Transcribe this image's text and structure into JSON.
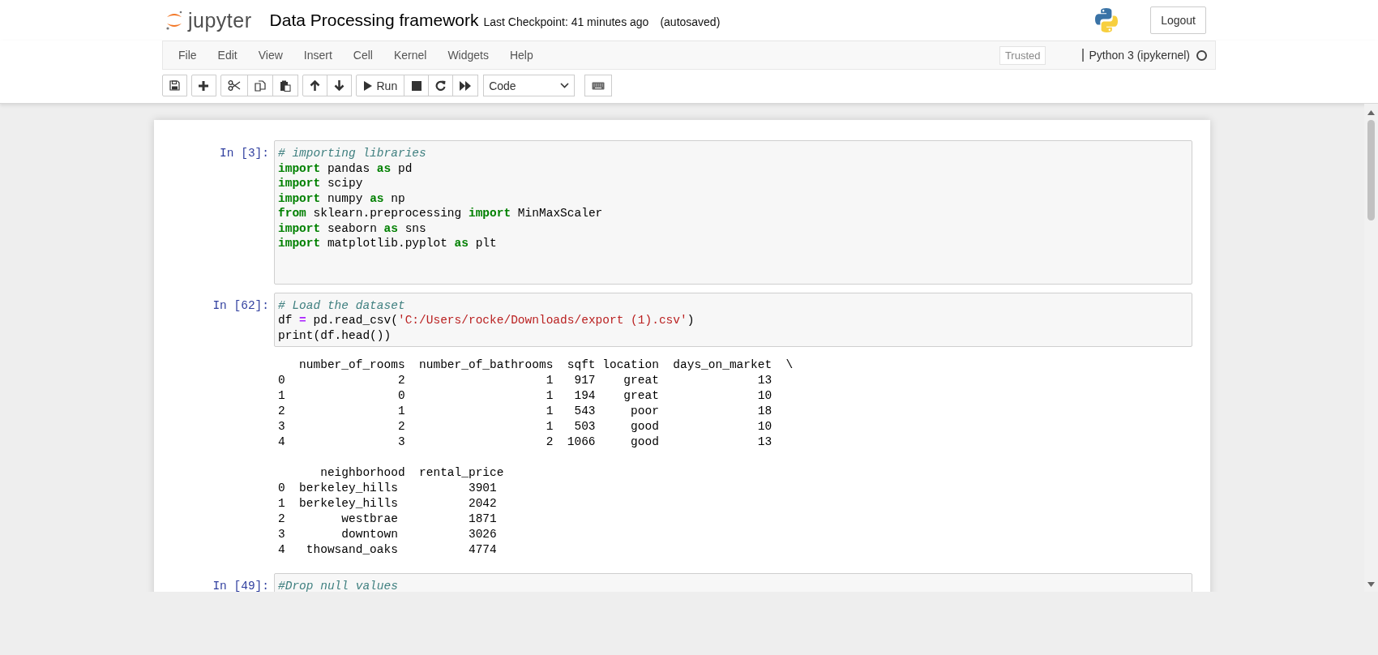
{
  "header": {
    "logo_text": "jupyter",
    "notebook_title": "Data Processing framework",
    "checkpoint": "Last Checkpoint: 41 minutes ago",
    "autosave": "(autosaved)",
    "logout": "Logout"
  },
  "menu": [
    "File",
    "Edit",
    "View",
    "Insert",
    "Cell",
    "Kernel",
    "Widgets",
    "Help"
  ],
  "trusted": "Trusted",
  "kernel": {
    "name": "Python 3 (ipykernel)",
    "busy": false
  },
  "toolbar": [
    {
      "group": [
        {
          "kind": "save"
        }
      ]
    },
    {
      "group": [
        {
          "kind": "add"
        }
      ]
    },
    {
      "group": [
        {
          "kind": "cut"
        },
        {
          "kind": "copy"
        },
        {
          "kind": "paste"
        }
      ]
    },
    {
      "group": [
        {
          "kind": "up"
        },
        {
          "kind": "down"
        }
      ]
    },
    {
      "group": [
        {
          "kind": "run",
          "label": "Run"
        },
        {
          "kind": "stop"
        },
        {
          "kind": "restart"
        },
        {
          "kind": "fastforward"
        }
      ]
    }
  ],
  "cell_type": "Code",
  "cells": [
    {
      "prompt": "In [3]:",
      "code": [
        [
          {
            "kind": "comment",
            "text": "# importing libraries"
          }
        ],
        [
          {
            "kind": "keyword",
            "text": "import"
          },
          {
            "kind": "plain",
            "text": " pandas "
          },
          {
            "kind": "keyword",
            "text": "as"
          },
          {
            "kind": "plain",
            "text": " pd"
          }
        ],
        [
          {
            "kind": "keyword",
            "text": "import"
          },
          {
            "kind": "plain",
            "text": " scipy"
          }
        ],
        [
          {
            "kind": "keyword",
            "text": "import"
          },
          {
            "kind": "plain",
            "text": " numpy "
          },
          {
            "kind": "keyword",
            "text": "as"
          },
          {
            "kind": "plain",
            "text": " np"
          }
        ],
        [
          {
            "kind": "keyword",
            "text": "from"
          },
          {
            "kind": "plain",
            "text": " sklearn.preprocessing "
          },
          {
            "kind": "keyword",
            "text": "import"
          },
          {
            "kind": "plain",
            "text": " MinMaxScaler"
          }
        ],
        [
          {
            "kind": "keyword",
            "text": "import"
          },
          {
            "kind": "plain",
            "text": " seaborn "
          },
          {
            "kind": "keyword",
            "text": "as"
          },
          {
            "kind": "plain",
            "text": " sns"
          }
        ],
        [
          {
            "kind": "keyword",
            "text": "import"
          },
          {
            "kind": "plain",
            "text": " matplotlib.pyplot "
          },
          {
            "kind": "keyword",
            "text": "as"
          },
          {
            "kind": "plain",
            "text": " plt"
          }
        ]
      ]
    },
    {
      "prompt": "In [62]:",
      "code": [
        [
          {
            "kind": "comment",
            "text": "# Load the dataset"
          }
        ],
        [
          {
            "kind": "plain",
            "text": "df "
          },
          {
            "kind": "operator",
            "text": "="
          },
          {
            "kind": "plain",
            "text": " pd.read_csv("
          },
          {
            "kind": "string",
            "text": "'C:/Users/rocke/Downloads/export (1).csv'"
          },
          {
            "kind": "plain",
            "text": ")"
          }
        ],
        [
          {
            "kind": "plain",
            "text": "print(df.head())"
          }
        ]
      ],
      "output": [
        [
          "   number_of_rooms  number_of_bathrooms  sqft location  days_on_market  \\",
          "0                2                    1   917    great              13",
          "1                0                    1   194    great              10",
          "2                1                    1   543     poor              18",
          "3                2                    1   503     good              10",
          "4                3                    2  1066     good              13"
        ],
        [
          "      neighborhood  rental_price",
          "0  berkeley_hills          3901",
          "1  berkeley_hills          2042",
          "2        westbrae          1871",
          "3        downtown          3026",
          "4   thowsand_oaks          4774"
        ]
      ]
    },
    {
      "prompt": "In [49]:",
      "code": [
        [
          {
            "kind": "comment",
            "text": "#Drop null values"
          }
        ]
      ]
    }
  ]
}
